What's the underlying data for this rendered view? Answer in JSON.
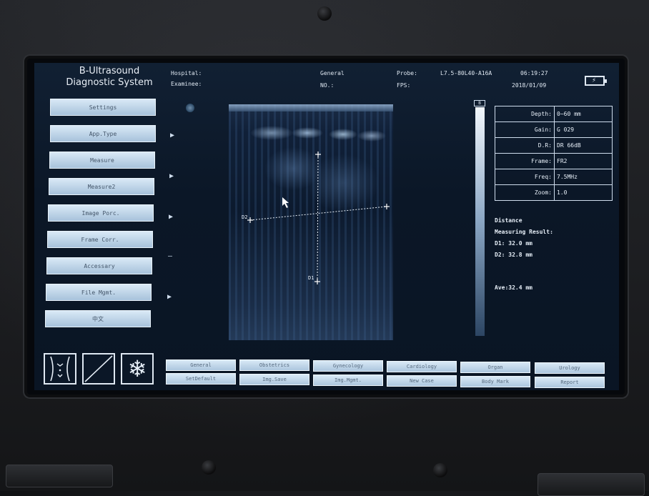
{
  "header": {
    "brand_line1": "B-Ultrasound",
    "brand_line2": "Diagnostic System",
    "hospital_label": "Hospital:",
    "examinee_label": "Examinee:",
    "mode": "General",
    "no_label": "NO.:",
    "probe_label": "Probe:",
    "probe_value": "L7.5-80L40-A16A",
    "fps_label": "FPS:",
    "time": "06:19:27",
    "date": "2018/01/09"
  },
  "side_menu": [
    {
      "label": "Settings"
    },
    {
      "label": "App.Type"
    },
    {
      "label": "Measure"
    },
    {
      "label": "Measure2"
    },
    {
      "label": "Image Porc."
    },
    {
      "label": "Frame Corr."
    },
    {
      "label": "Accessary"
    },
    {
      "label": "File Mgmt."
    },
    {
      "label": "中文"
    }
  ],
  "side_arrows": [
    "▶",
    "▶",
    "▶",
    "—",
    "▶"
  ],
  "grayscale_label": "B",
  "params": [
    {
      "key": "Depth:",
      "value": "0~60 mm"
    },
    {
      "key": "Gain:",
      "value": "G 029"
    },
    {
      "key": "D.R:",
      "value": "DR 66dB"
    },
    {
      "key": "Frame:",
      "value": "FR2"
    },
    {
      "key": "Freq:",
      "value": "7.5MHz"
    },
    {
      "key": "Zoom:",
      "value": "1.0"
    }
  ],
  "measurement": {
    "title": "Distance",
    "result_label": "Measuring Result:",
    "d1": "D1: 32.0 mm",
    "d2": "D2: 32.8 mm",
    "ave": "Ave:32.4 mm",
    "d1_marker": "D1",
    "d2_marker": "D2"
  },
  "bottom_row1": [
    "General",
    "Obstetrics",
    "Gynecology",
    "Cardiology",
    "Organ",
    "Urology"
  ],
  "bottom_row2": [
    "SetDefault",
    "Img.Save",
    "Img.Mgmt.",
    "New Case",
    "Body Mark",
    "Report"
  ],
  "icons": [
    "body-mark-icon",
    "probe-angle-icon",
    "freeze-snowflake-icon",
    "battery-icon"
  ]
}
